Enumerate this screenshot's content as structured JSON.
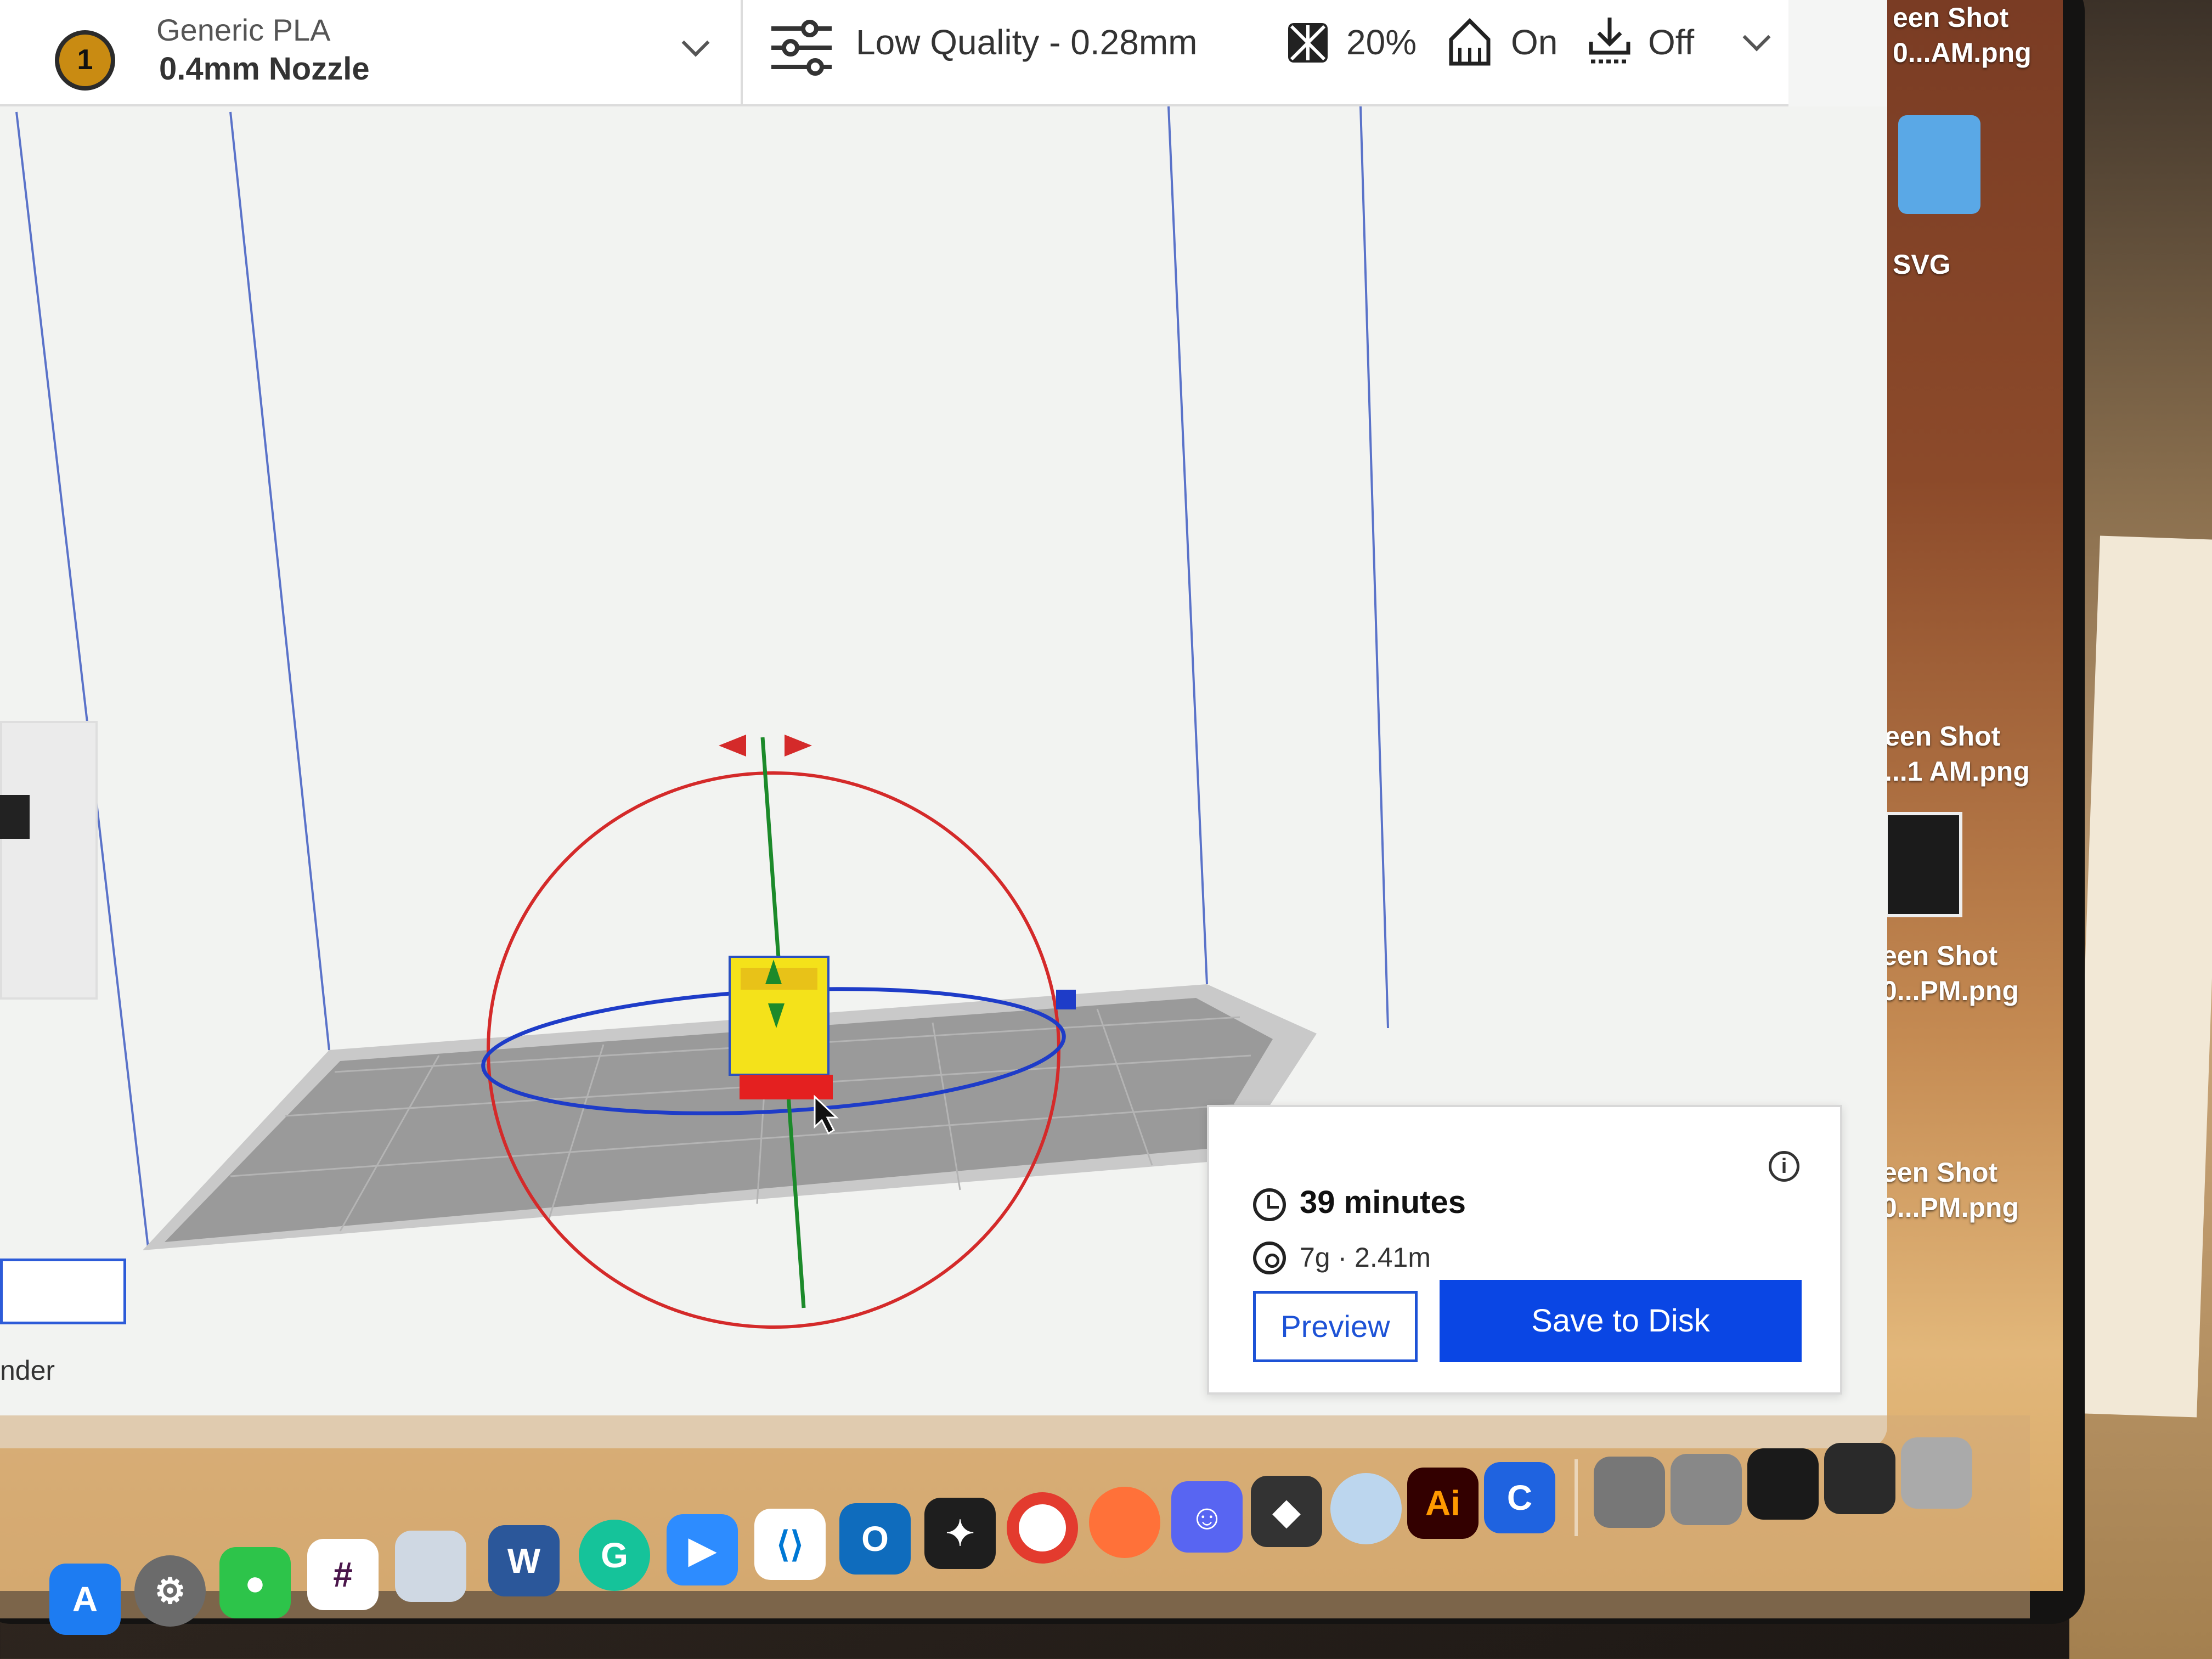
{
  "toolbar": {
    "extruder_number": "1",
    "material": "Generic PLA",
    "nozzle": "0.4mm Nozzle",
    "profile": "Low Quality - 0.28mm",
    "infill": "20%",
    "support": "On",
    "adhesion": "Off"
  },
  "print_panel": {
    "time": "39 minutes",
    "material_usage": "7g · 2.41m",
    "preview_label": "Preview",
    "save_label": "Save to Disk"
  },
  "sidebar": {
    "partial_label": "nder"
  },
  "desktop_files": [
    {
      "line1": "een Shot",
      "line2": "0...AM.png"
    },
    {
      "line1": "SVG",
      "line2": ""
    },
    {
      "line1": "een Shot",
      "line2": "...1 AM.png"
    },
    {
      "line1": "een Shot",
      "line2": "0...PM.png"
    },
    {
      "line1": "een Shot",
      "line2": "0...PM.png"
    }
  ],
  "dock": {
    "icons": [
      "app-store",
      "system-settings",
      "wechat",
      "slack",
      "preview",
      "word",
      "grammarly",
      "zoom",
      "vscode",
      "outlook",
      "figma",
      "chrome",
      "firefox",
      "discord",
      "inkscape",
      "quicktime",
      "illustrator",
      "c-app"
    ],
    "ai_label": "Ai",
    "c_label": "C",
    "w_label": "W"
  },
  "colors": {
    "accent": "#0a46e4",
    "rotate_ring_red": "#d42a2a",
    "rotate_ring_blue": "#1e3cc8",
    "axis_green": "#1c8a2a",
    "model_yellow": "#f4e21a",
    "model_red": "#e42020"
  }
}
